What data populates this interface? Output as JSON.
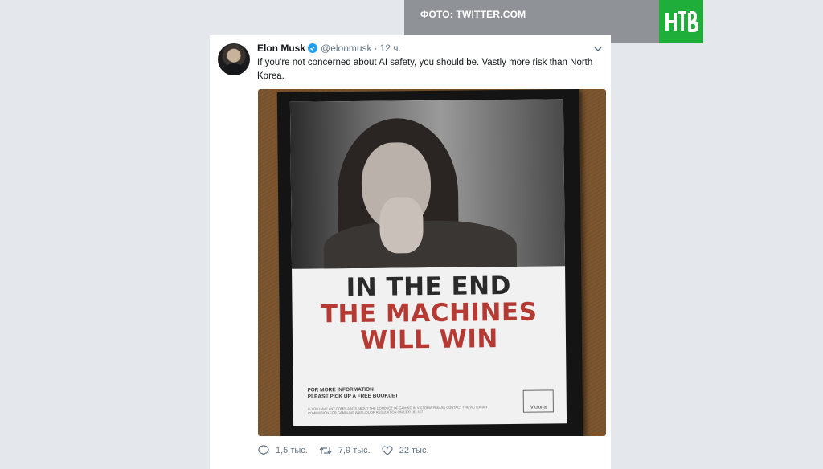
{
  "credit": {
    "text": "ФОТО: TWITTER.COM"
  },
  "logo": {
    "text": "НТВ",
    "color": "#1fae3a"
  },
  "tweet": {
    "display_name": "Elon Musk",
    "handle": "@elonmusk",
    "separator": "·",
    "timestamp": "12 ч.",
    "text": "If you're not concerned about AI safety, you should be. Vastly more risk than North Korea.",
    "verified_color": "#1da1f2",
    "media": {
      "poster_line1": "IN THE END",
      "poster_line2": "THE MACHINES",
      "poster_line3": "WILL WIN",
      "poster_info": "FOR MORE INFORMATION\nPLEASE PICK UP A FREE BOOKLET",
      "poster_fine_print": "IF YOU HAVE ANY COMPLAINTS ABOUT THE CONDUCT OF GAMING IN VICTORIA PLEASE CONTACT THE VICTORIAN COMMISSION FOR GAMBLING AND LIQUOR REGULATION ON 1300 182 457",
      "poster_logo": "Victoria"
    },
    "actions": {
      "replies": "1,5 тыс.",
      "retweets": "7,9 тыс.",
      "likes": "22 тыс."
    }
  }
}
